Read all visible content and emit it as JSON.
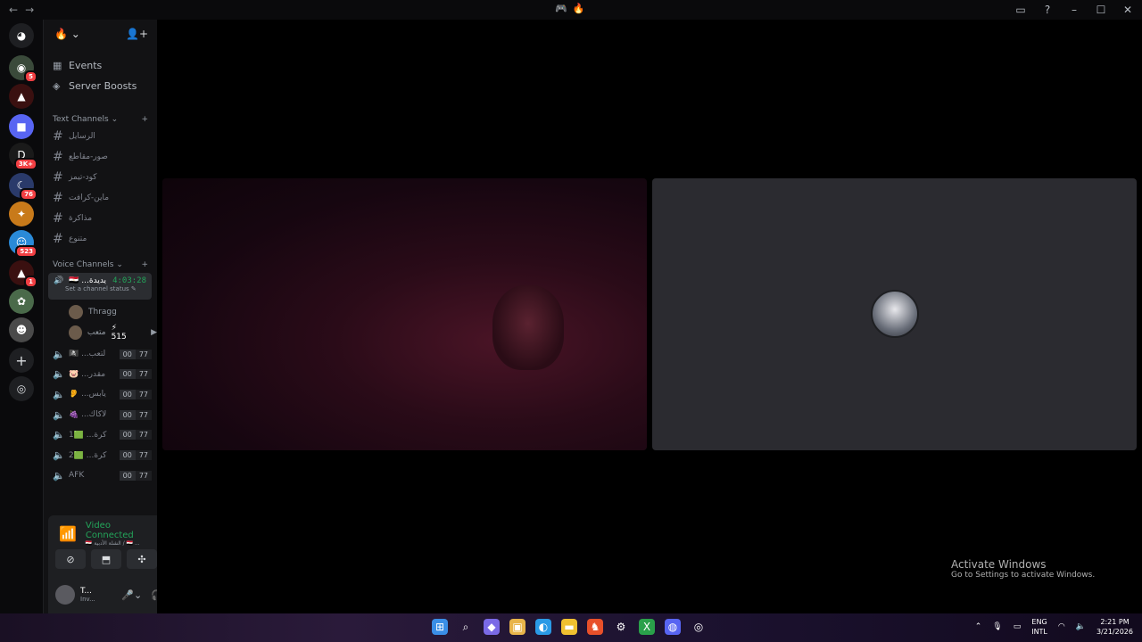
{
  "titlebar": {
    "back": "←",
    "forward": "→",
    "center_icon_1": "🎮",
    "center_icon_2": "🔥",
    "right_icons": [
      "inbox-icon",
      "help-icon",
      "minimize-icon",
      "maximize-icon",
      "close-icon"
    ],
    "right_glyphs": [
      "▭",
      "?",
      "–",
      "☐",
      "✕"
    ]
  },
  "guilds": [
    {
      "label": "◉",
      "badge": "5",
      "color": "#3a4a3a"
    },
    {
      "label": "▲",
      "badge": "",
      "color": "#3a1010"
    },
    {
      "label": "■",
      "badge": "",
      "color": "#5865f2"
    },
    {
      "label": "D",
      "badge": "3K+",
      "color": "#1a1a1a"
    },
    {
      "label": "☾",
      "badge": "76",
      "color": "#2a3a6a"
    },
    {
      "label": "✦",
      "badge": "",
      "color": "#c87a1a"
    },
    {
      "label": "☺",
      "badge": "523",
      "color": "#2a8ad8"
    },
    {
      "label": "▲",
      "badge": "1",
      "color": "#3a1010"
    },
    {
      "label": "✿",
      "badge": "",
      "color": "#4a6a4a"
    },
    {
      "label": "☻",
      "badge": "",
      "color": "#4a4a4a"
    }
  ],
  "server": {
    "name_icon": "🔥",
    "events": "Events",
    "boosts": "Server Boosts",
    "text_category": "Text Channels",
    "text_channels": [
      "الرسايل",
      "صور-مقاطع",
      "كود-تيمز",
      "ماين-كرافت",
      "مذاكرة",
      "متنوع"
    ],
    "voice_category": "Voice Channels",
    "active_voice": {
      "name": "🇪🇬 ...يديدة",
      "timer": "4:03:28",
      "status": "Set a channel status"
    },
    "members": [
      {
        "name": "Thragg",
        "extra": ""
      },
      {
        "name": "متعب",
        "extra": "⚡ 515"
      }
    ],
    "voice_channels": [
      {
        "name": "🏴‍☠️ ...لتعب",
        "a": "00",
        "b": "77"
      },
      {
        "name": "🐷 ...مقدر",
        "a": "00",
        "b": "77"
      },
      {
        "name": "👂 ...يابس",
        "a": "00",
        "b": "77"
      },
      {
        "name": "🍇 ...لاكاك",
        "a": "00",
        "b": "77"
      },
      {
        "name": "1🟩 ...كرة",
        "a": "00",
        "b": "77"
      },
      {
        "name": "2🟩 ...كرة",
        "a": "00",
        "b": "77"
      },
      {
        "name": "AFK",
        "a": "00",
        "b": "77"
      }
    ]
  },
  "voice_panel": {
    "status": "Video Connected",
    "channel": "🇪🇬 الشلة الأدبية / 🇪🇬 ...",
    "user_name": "T...",
    "user_status": "Inv..."
  },
  "stage": {
    "watermark_title": "Activate Windows",
    "watermark_sub": "Go to Settings to activate Windows."
  },
  "taskbar": {
    "apps": [
      {
        "glyph": "⊞",
        "color": "#3a8ee6"
      },
      {
        "glyph": "⌕",
        "color": "transparent"
      },
      {
        "glyph": "◆",
        "color": "#7a6ae6"
      },
      {
        "glyph": "▣",
        "color": "#e8b44a"
      },
      {
        "glyph": "◐",
        "color": "#2a9ae6"
      },
      {
        "glyph": "▬",
        "color": "#f0c030"
      },
      {
        "glyph": "♞",
        "color": "#e8502a"
      },
      {
        "glyph": "⚙",
        "color": "transparent"
      },
      {
        "glyph": "X",
        "color": "#2aa04a"
      },
      {
        "glyph": "◍",
        "color": "#5865f2"
      },
      {
        "glyph": "◎",
        "color": "transparent"
      }
    ],
    "lang_1": "ENG",
    "lang_2": "INTL",
    "time": "2:21 PM",
    "date": "3/21/2026"
  }
}
